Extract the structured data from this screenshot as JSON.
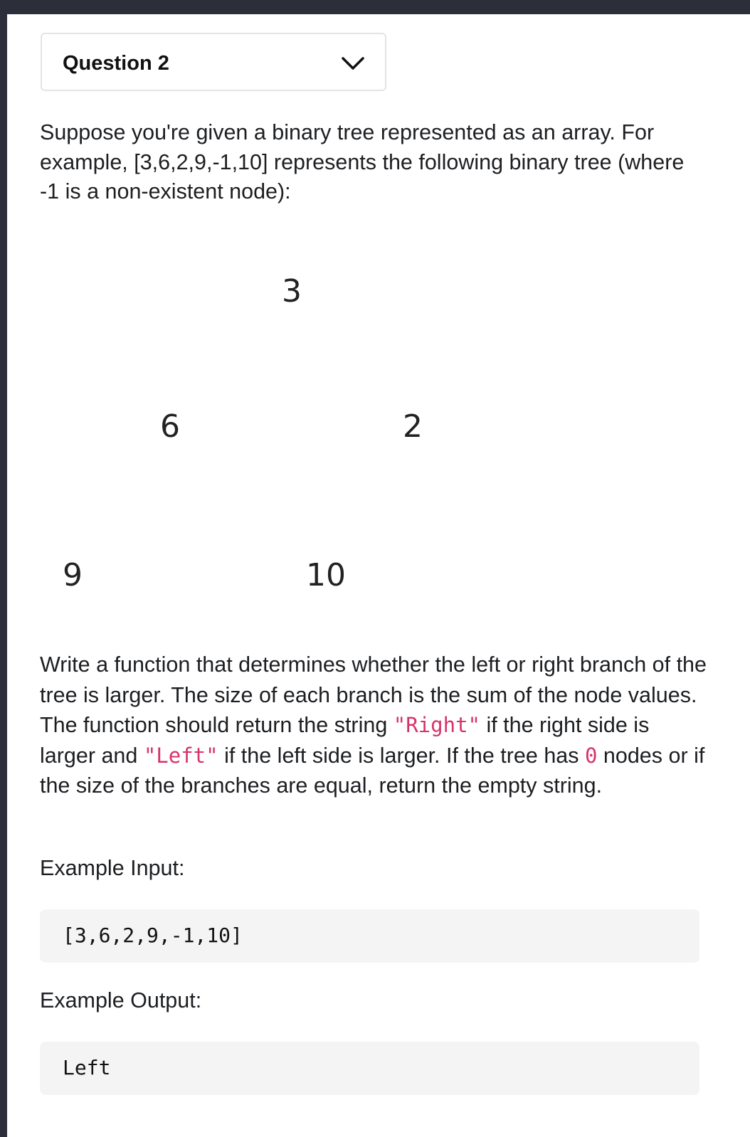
{
  "question_selector": {
    "label": "Question 2"
  },
  "description": {
    "intro": "Suppose you're given a binary tree represented as an array. For example, [3,6,2,9,-1,10] represents the following binary tree (where -1 is a non-existent node):",
    "task_part1": "Write a function that determines whether the left or right branch of the tree is larger. The size of each branch is the sum of the node values. The function should return the string ",
    "right_literal": "\"Right\"",
    "task_part2": " if the right side is larger and ",
    "left_literal": "\"Left\"",
    "task_part3": " if the left side is larger. If the tree has ",
    "zero_literal": "0",
    "task_part4": " nodes or if the size of the branches are equal, return the empty string."
  },
  "tree": {
    "root": "3",
    "left": "6",
    "right": "2",
    "left_left": "9",
    "left_right": "10"
  },
  "example_input": {
    "heading": "Example Input:",
    "value": "[3,6,2,9,-1,10]"
  },
  "example_output": {
    "heading": "Example Output:",
    "value": "Left"
  },
  "colors": {
    "inline_code": "#d6336c",
    "code_block_bg": "#f4f4f5",
    "frame": "#2c2f3a"
  }
}
